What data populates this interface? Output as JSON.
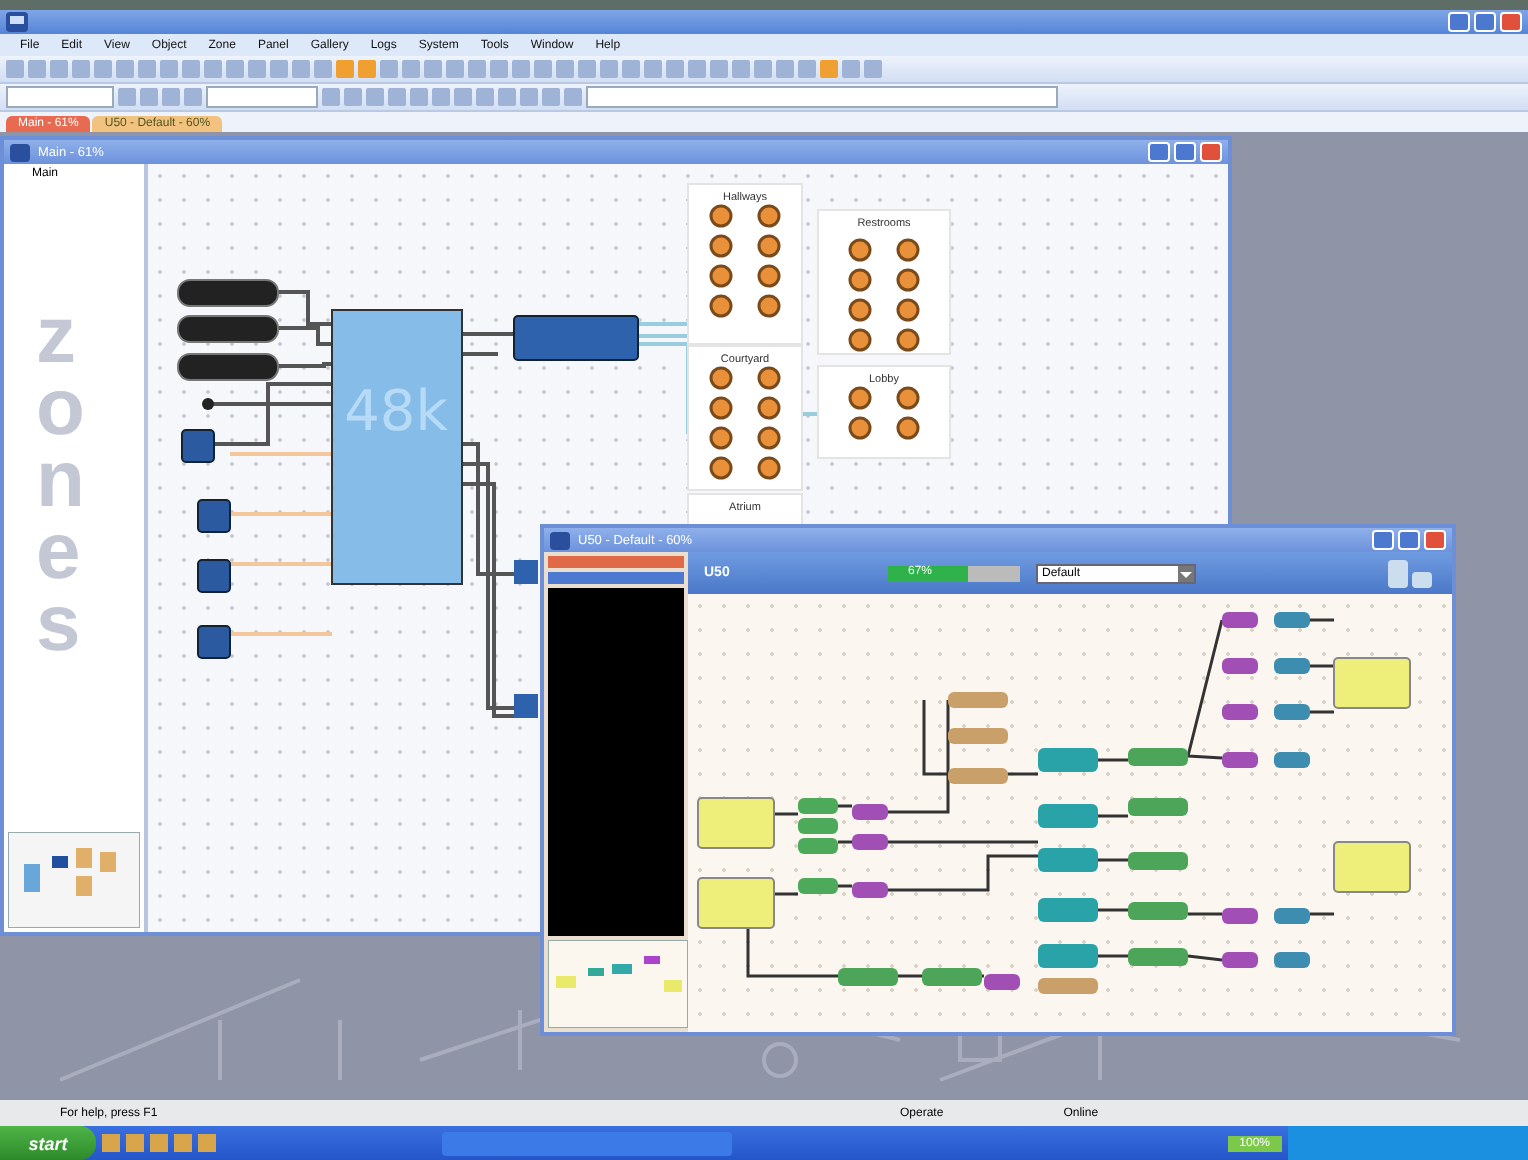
{
  "menu": [
    "File",
    "Edit",
    "View",
    "Object",
    "Zone",
    "Panel",
    "Gallery",
    "Logs",
    "System",
    "Tools",
    "Window",
    "Help"
  ],
  "tabs": [
    {
      "label": "Main - 61%",
      "selected": true
    },
    {
      "label": "U50 - Default - 60%",
      "selected": false
    }
  ],
  "main_window": {
    "title": "Main - 61%",
    "tree_root": "Main",
    "sidebar_watermark": "zones",
    "processor_label": "48k",
    "zones": [
      {
        "label": "Hallways",
        "kind": "large"
      },
      {
        "label": "Restrooms",
        "kind": "large"
      },
      {
        "label": "Courtyard",
        "kind": "large"
      },
      {
        "label": "Lobby",
        "kind": "small"
      },
      {
        "label": "Atrium",
        "kind": "cut"
      }
    ]
  },
  "u50_window": {
    "title": "U50 - Default - 60%",
    "device_label": "U50",
    "meter": {
      "level": 0.6,
      "reading": "67%"
    },
    "preset": {
      "value": "Default"
    }
  },
  "status_bar": {
    "help": "For help, press F1",
    "mode": "Operate",
    "connection": "Online"
  },
  "taskbar": {
    "start": "start",
    "tray_level": "100%"
  }
}
